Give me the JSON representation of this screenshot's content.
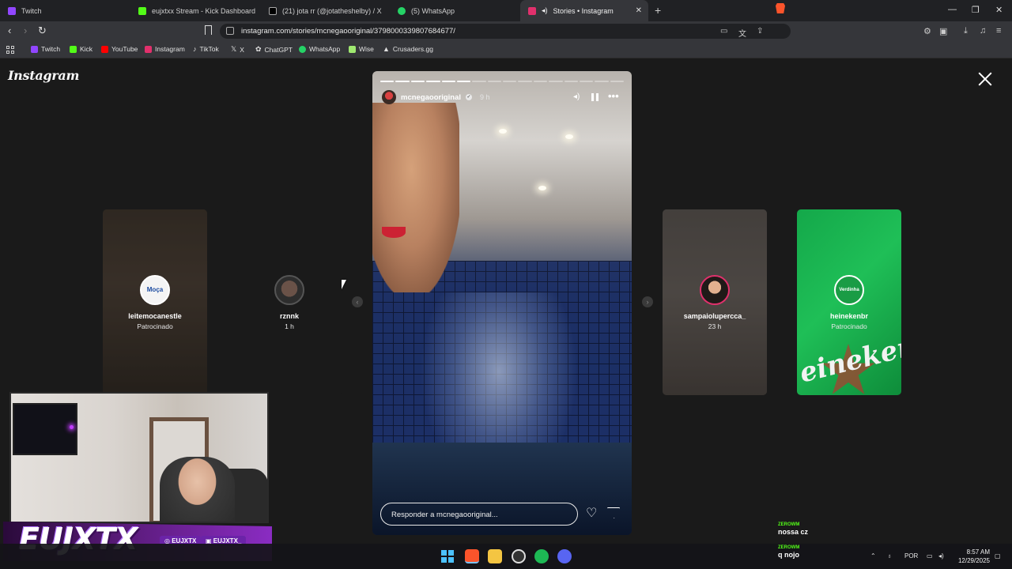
{
  "browser": {
    "tabs": [
      {
        "label": "Twitch",
        "color": "#9146ff"
      },
      {
        "label": "eujxtxx Stream - Kick Dashboard",
        "color": "#53fc18"
      },
      {
        "label": "(21) jota rr (@jotatheshelby) / X",
        "color": "#e7e9ea"
      },
      {
        "label": "(5) WhatsApp",
        "color": "#25d366"
      },
      {
        "label": "Stories • Instagram",
        "color": "#e1306c"
      }
    ],
    "url": "instagram.com/stories/mcnegaooriginal/3798000339807684677/",
    "bookmarks": [
      {
        "label": "Twitch",
        "color": "#9146ff"
      },
      {
        "label": "Kick",
        "color": "#53fc18"
      },
      {
        "label": "YouTube",
        "color": "#ff0000"
      },
      {
        "label": "Instagram",
        "color": "#e1306c"
      },
      {
        "label": "TikTok",
        "color": "#ffffff"
      },
      {
        "label": "X",
        "color": "#e7e9ea"
      },
      {
        "label": "ChatGPT",
        "color": "#cfcfcf"
      },
      {
        "label": "WhatsApp",
        "color": "#25d366"
      },
      {
        "label": "Wise",
        "color": "#9fe870"
      },
      {
        "label": "Crusaders.gg",
        "color": "#dddddd"
      }
    ]
  },
  "instagram": {
    "logo": "Instagram",
    "main_story": {
      "username": "mcnegaooriginal",
      "time": "9 h",
      "reply_placeholder": "Responder a mcnegaooriginal...",
      "segments_total": 16,
      "segments_done": 6
    },
    "side_stories": [
      {
        "username": "leitemocanestle",
        "sub": "Patrocinado",
        "avatar_text": "Moça",
        "avatar_color": "#f4f4f4"
      },
      {
        "username": "rznnk",
        "sub": "1 h",
        "avatar_color": "#3a3a3a"
      },
      {
        "username": "sampaiolupercca_",
        "sub": "23 h",
        "avatar_color": "#4a3a36"
      },
      {
        "username": "heinekenbr",
        "sub": "Patrocinado",
        "avatar_text": "Verdinha",
        "avatar_color": "#1a9c45"
      }
    ]
  },
  "stream_overlay": {
    "brand": "EUJXTX",
    "socials": [
      "EUJXTX",
      "EUJXTX_"
    ]
  },
  "chat": [
    {
      "user": "ZEROWM",
      "text": "nossa cz"
    },
    {
      "user": "ZEROWM",
      "text": "q nojo"
    }
  ],
  "taskbar": {
    "language": "POR",
    "time": "8:57 AM",
    "date": "12/29/2025"
  }
}
